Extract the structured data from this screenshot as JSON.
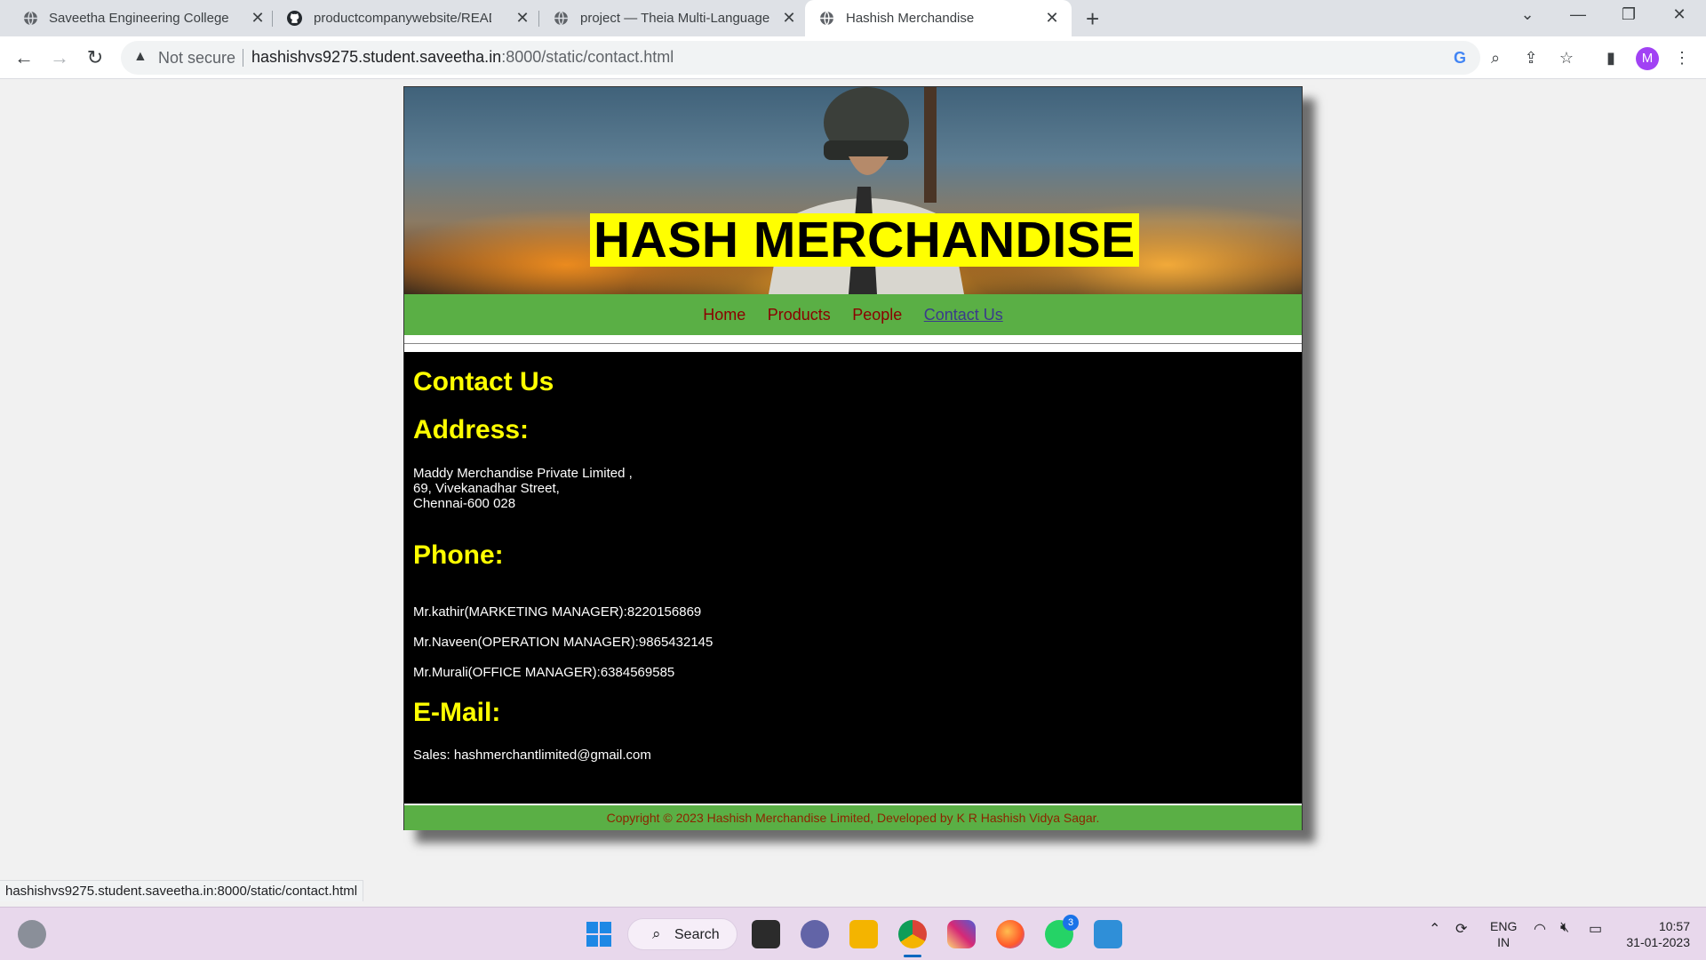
{
  "browser": {
    "tabs": [
      {
        "title": "Saveetha Engineering College",
        "icon": "globe-icon",
        "active": false
      },
      {
        "title": "productcompanywebsite/READM",
        "icon": "github-icon",
        "active": false
      },
      {
        "title": "project — Theia Multi-Language",
        "icon": "globe-icon",
        "active": false
      },
      {
        "title": "Hashish Merchandise",
        "icon": "globe-icon",
        "active": true
      }
    ],
    "security_label": "Not secure",
    "url_host": "hashishvs9275.student.saveetha.in",
    "url_rest": ":8000/static/contact.html",
    "profile_initial": "M",
    "status_url": "hashishvs9275.student.saveetha.in:8000/static/contact.html"
  },
  "site": {
    "title": "HASH MERCHANDISE",
    "nav": [
      {
        "label": "Home",
        "current": false
      },
      {
        "label": "Products",
        "current": false
      },
      {
        "label": "People",
        "current": false
      },
      {
        "label": "Contact Us",
        "current": true
      }
    ],
    "heading": "Contact Us",
    "address_heading": "Address:",
    "address_lines": [
      "Maddy Merchandise Private Limited ,",
      "69, Vivekanadhar Street,",
      "Chennai-600 028"
    ],
    "phone_heading": "Phone:",
    "phones": [
      "Mr.kathir(MARKETING MANAGER):8220156869",
      "Mr.Naveen(OPERATION MANAGER):9865432145",
      "Mr.Murali(OFFICE MANAGER):6384569585"
    ],
    "email_heading": "E-Mail:",
    "email_line": "Sales: hashmerchantlimited@gmail.com",
    "footer": "Copyright © 2023 Hashish Merchandise Limited, Developed by K R Hashish Vidya Sagar.",
    "colors": {
      "title_bg": "#ffff00",
      "nav_bg": "#5aaf45",
      "heading": "#ffff00",
      "content_bg": "#000000"
    }
  },
  "taskbar": {
    "search_label": "Search",
    "whatsapp_badge": "3",
    "lang_top": "ENG",
    "lang_bottom": "IN",
    "time": "10:57",
    "date": "31-01-2023"
  }
}
